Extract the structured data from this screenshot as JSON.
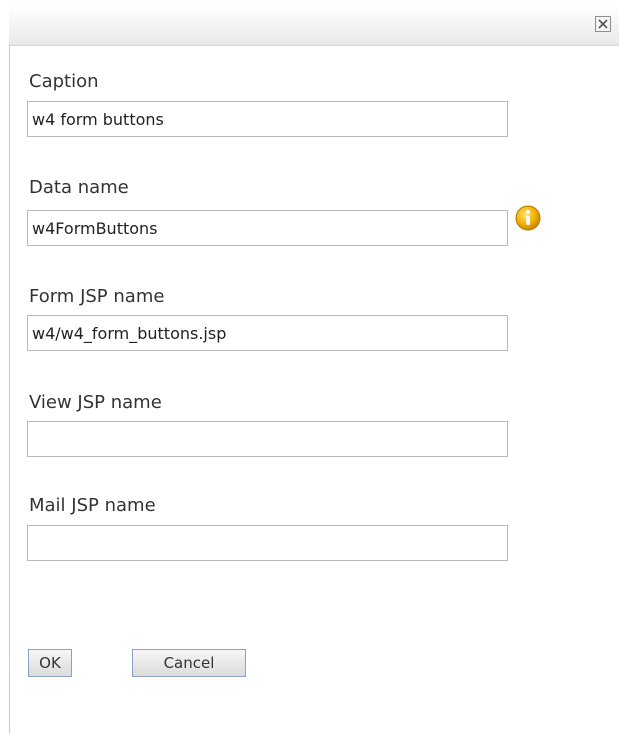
{
  "dialog": {
    "close_icon": "close-icon"
  },
  "fields": [
    {
      "label": "Caption",
      "value": "w4 form buttons"
    },
    {
      "label": "Data name",
      "value": "w4FormButtons",
      "info_icon": "info-icon"
    },
    {
      "label": "Form JSP name",
      "value": "w4/w4_form_buttons.jsp"
    },
    {
      "label": "View JSP name",
      "value": ""
    },
    {
      "label": "Mail JSP name",
      "value": ""
    }
  ],
  "buttons": {
    "ok_label": "OK",
    "cancel_label": "Cancel"
  },
  "colors": {
    "info_icon": "#e8a400",
    "button_border": "#8aa3c4"
  }
}
